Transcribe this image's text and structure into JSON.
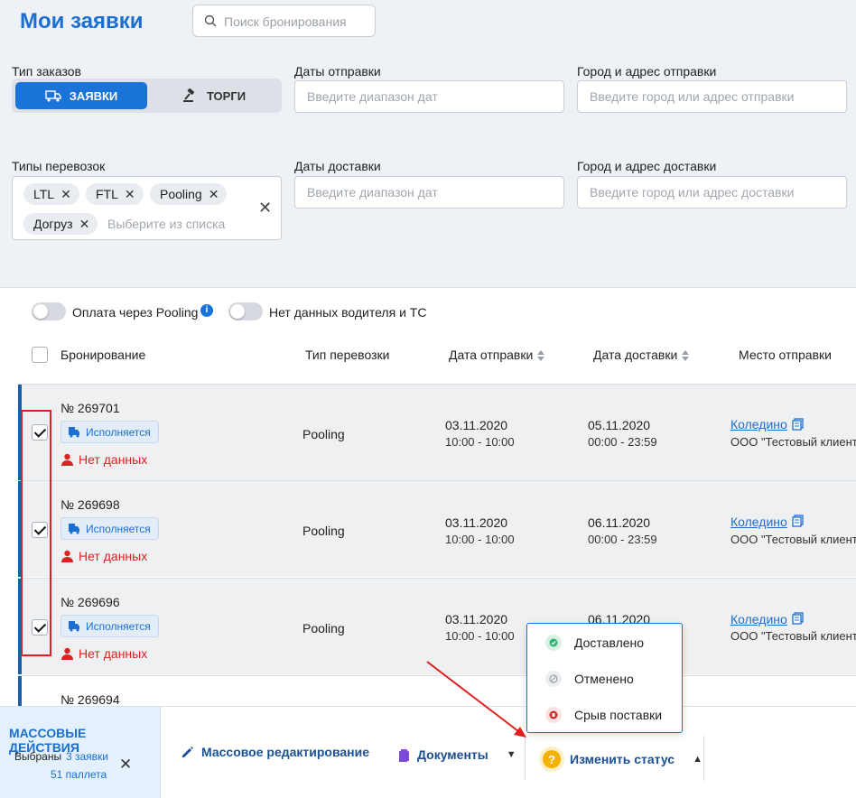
{
  "header": {
    "title": "Мои заявки",
    "search_placeholder": "Поиск бронирования"
  },
  "filters": {
    "order_type_label": "Тип заказов",
    "segments": [
      "ЗАЯВКИ",
      "ТОРГИ"
    ],
    "ship_dates_label": "Даты отправки",
    "ship_dates_placeholder": "Введите диапазон дат",
    "ship_city_label": "Город и адрес отправки",
    "ship_city_placeholder": "Введите город или адрес отправки",
    "transport_types_label": "Типы перевозок",
    "transport_types_chips": [
      "LTL",
      "FTL",
      "Pooling",
      "Догруз"
    ],
    "transport_types_placeholder": "Выберите из списка",
    "delivery_dates_label": "Даты доставки",
    "delivery_dates_placeholder": "Введите диапазон дат",
    "delivery_city_label": "Город и адрес доставки",
    "delivery_city_placeholder": "Введите город или адрес доставки"
  },
  "toggles": {
    "pooling_payment": "Оплата через Pooling",
    "no_driver_data": "Нет данных водителя и ТС"
  },
  "table": {
    "columns": {
      "booking": "Бронирование",
      "transport_type": "Тип перевозки",
      "ship_date": "Дата отправки",
      "delivery_date": "Дата доставки",
      "ship_place": "Место отправки"
    },
    "rows": [
      {
        "number": "№ 269701",
        "status": "Исполняется",
        "driver": "Нет данных",
        "type": "Pooling",
        "ship_date": "03.11.2020",
        "ship_time": "10:00 - 10:00",
        "delivery_date": "05.11.2020",
        "delivery_time": "00:00 - 23:59",
        "place": "Коледино",
        "client": "ООО \"Тестовый клиент\"",
        "checked": true
      },
      {
        "number": "№ 269698",
        "status": "Исполняется",
        "driver": "Нет данных",
        "type": "Pooling",
        "ship_date": "03.11.2020",
        "ship_time": "10:00 - 10:00",
        "delivery_date": "06.11.2020",
        "delivery_time": "00:00 - 23:59",
        "place": "Коледино",
        "client": "ООО \"Тестовый клиент\"",
        "checked": true
      },
      {
        "number": "№ 269696",
        "status": "Исполняется",
        "driver": "Нет данных",
        "type": "Pooling",
        "ship_date": "03.11.2020",
        "ship_time": "10:00 - 10:00",
        "delivery_date": "06.11.2020",
        "delivery_time": "",
        "place": "Коледино",
        "client": "ООО \"Тестовый клиент\"",
        "checked": true
      },
      {
        "number": "№ 269694"
      }
    ]
  },
  "status_menu": {
    "items": [
      {
        "label": "Доставлено",
        "color": "#2bb673"
      },
      {
        "label": "Отменено",
        "color": "#9aa0a8"
      },
      {
        "label": "Срыв поставки",
        "color": "#d22b2b"
      }
    ]
  },
  "bottom_bar": {
    "mass_title": "МАССОВЫЕ ДЕЙСТВИЯ",
    "selected_label": "Выбраны",
    "selected_orders": "3 заявки",
    "selected_pallets": "51 паллета",
    "mass_edit": "Массовое редактирование",
    "documents": "Документы",
    "change_status": "Изменить статус"
  },
  "colors": {
    "accent": "#1a73d9",
    "error": "#d22b2b",
    "annotation": "#e02020"
  }
}
